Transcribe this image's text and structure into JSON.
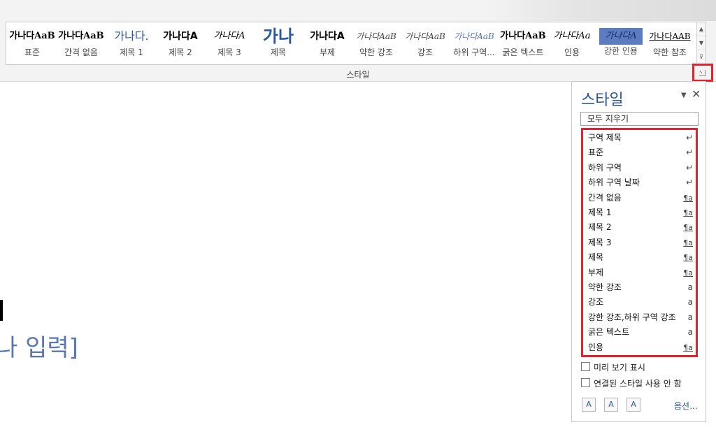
{
  "ribbon": {
    "group_label": "스타일",
    "gallery": [
      {
        "preview": "가나다AaB",
        "name": "표준",
        "selected": false
      },
      {
        "preview": "가나다AaB",
        "name": "간격 없음",
        "selected": false
      },
      {
        "preview": "가나다.",
        "name": "제목 1",
        "selected": false
      },
      {
        "preview": "가나다A",
        "name": "제목 2",
        "selected": false
      },
      {
        "preview": "가나다A",
        "name": "제목 3",
        "selected": false
      },
      {
        "preview": "가나",
        "name": "제목",
        "selected": false
      },
      {
        "preview": "가나다A",
        "name": "부제",
        "selected": false
      },
      {
        "preview": "가나다AaB",
        "name": "약한 강조",
        "selected": false
      },
      {
        "preview": "가나다AaB",
        "name": "강조",
        "selected": false
      },
      {
        "preview": "가나다AaB",
        "name": "하위 구역...",
        "selected": false
      },
      {
        "preview": "가나다AaB",
        "name": "굵은 텍스트",
        "selected": false
      },
      {
        "preview": "가나다Aa",
        "name": "인용",
        "selected": false
      },
      {
        "preview": "가나다A",
        "name": "강한 인용",
        "selected": true
      },
      {
        "preview": "가나다AAB",
        "name": "약한 참조",
        "selected": false
      }
    ],
    "scroll_up": "▲",
    "scroll_down": "▼",
    "scroll_more": "⊽"
  },
  "document": {
    "placeholder": "나 입력]"
  },
  "pane": {
    "title": "스타일",
    "menu_glyph": "▼",
    "close_glyph": "✕",
    "clear_all": "모두 지우기",
    "styles": [
      {
        "name": "구역 제목",
        "icon": "↵",
        "kind": "para"
      },
      {
        "name": "표준",
        "icon": "↵",
        "kind": "para"
      },
      {
        "name": "하위 구역",
        "icon": "↵",
        "kind": "para"
      },
      {
        "name": "하위 구역 날짜",
        "icon": "↵",
        "kind": "para"
      },
      {
        "name": "간격 없음",
        "icon": "¶a",
        "kind": "linked"
      },
      {
        "name": "제목 1",
        "icon": "¶a",
        "kind": "linked"
      },
      {
        "name": "제목 2",
        "icon": "¶a",
        "kind": "linked"
      },
      {
        "name": "제목 3",
        "icon": "¶a",
        "kind": "linked"
      },
      {
        "name": "제목",
        "icon": "¶a",
        "kind": "linked"
      },
      {
        "name": "부제",
        "icon": "¶a",
        "kind": "linked"
      },
      {
        "name": "약한 강조",
        "icon": "a",
        "kind": "char"
      },
      {
        "name": "강조",
        "icon": "a",
        "kind": "char"
      },
      {
        "name": "강한 강조,하위 구역 강조",
        "icon": "a",
        "kind": "char"
      },
      {
        "name": "굵은 텍스트",
        "icon": "a",
        "kind": "char"
      },
      {
        "name": "인용",
        "icon": "¶a",
        "kind": "linked"
      }
    ],
    "show_preview": "미리 보기 표시",
    "disable_linked": "연결된 스타일 사용 안 함",
    "options": "옵션...",
    "buttons": [
      {
        "glyph": "A",
        "label": "new-style"
      },
      {
        "glyph": "A",
        "label": "style-inspector"
      },
      {
        "glyph": "A",
        "label": "manage-styles"
      }
    ]
  },
  "colors": {
    "highlight": "#e3222b",
    "accent": "#2b579a",
    "selected_style": "#5b7cc0"
  }
}
